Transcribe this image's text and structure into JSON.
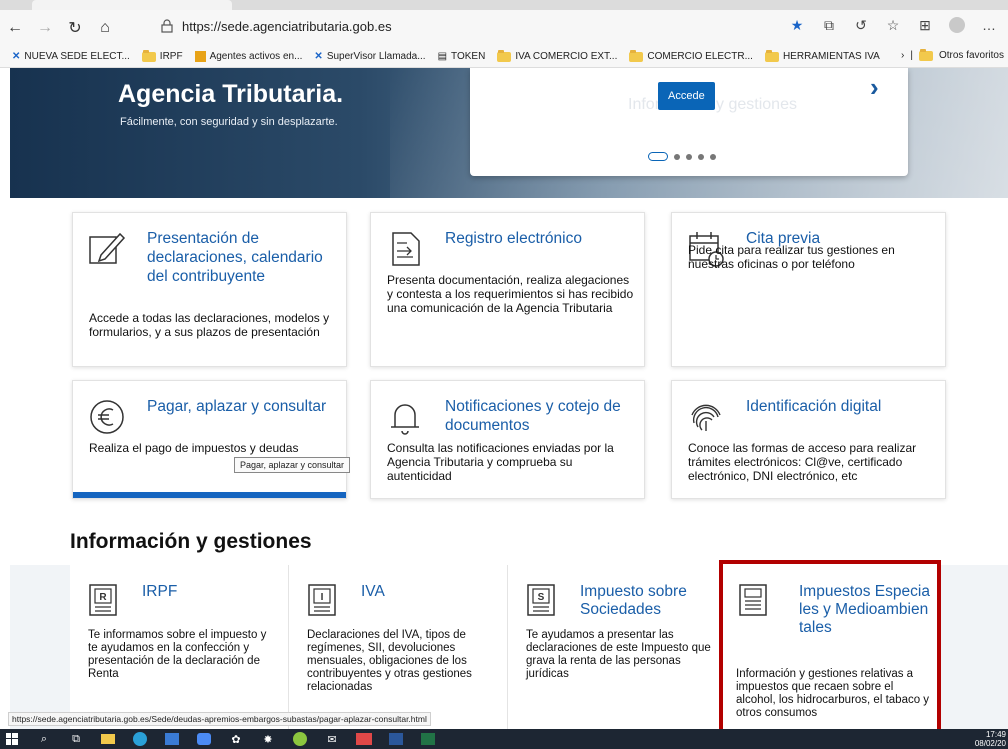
{
  "browser": {
    "url": "https://sede.agenciatributaria.gob.es",
    "bookmarks": [
      "NUEVA SEDE ELECT...",
      "IRPF",
      "Agentes activos en...",
      "SuperVisor Llamada...",
      "TOKEN",
      "IVA COMERCIO EXT...",
      "COMERCIO ELECTR...",
      "HERRAMIENTAS IVA"
    ],
    "bookmarks_more": "Otros favoritos"
  },
  "hero": {
    "title": "Agencia Tributaria.",
    "subtitle": "Fácilmente, con seguridad y sin desplazarte.",
    "button": "Accede",
    "carousel_ghost": "Información y gestiones"
  },
  "cards": [
    {
      "icon": "pencil-square-icon",
      "title": "Presentación de declaraciones, calendario del contribuyente",
      "desc": "Accede a todas las declaraciones, modelos y formularios, y a sus plazos de presentación"
    },
    {
      "icon": "document-arrow-icon",
      "title": "Registro electrónico",
      "desc": "Presenta documentación, realiza alegaciones y contesta a los requerimientos si has recibido una comunicación de la Agencia Tributaria"
    },
    {
      "icon": "calendar-clock-icon",
      "title": "Cita previa",
      "desc": "Pide cita para realizar tus gestiones en nuestras oficinas o por teléfono"
    },
    {
      "icon": "euro-circle-icon",
      "title": "Pagar, aplazar y consultar",
      "desc": "Realiza el pago de impuestos y deudas"
    },
    {
      "icon": "bell-icon",
      "title": "Notificaciones y cotejo de documentos",
      "desc": "Consulta las notificaciones enviadas por la Agencia Tributaria y comprueba su autenticidad"
    },
    {
      "icon": "fingerprint-icon",
      "title": "Identificación digital",
      "desc": "Conoce las formas de acceso para realizar trámites electrónicos: Cl@ve, certificado electrónico, DNI electrónico, etc"
    }
  ],
  "tooltip": "Pagar, aplazar y consultar",
  "section": {
    "title": "Información y gestiones",
    "items": [
      {
        "letter": "R",
        "title": "IRPF",
        "desc": "Te informamos sobre el impuesto y te ayudamos en la confección y presentación de la declaración de Renta"
      },
      {
        "letter": "I",
        "title": "IVA",
        "desc": "Declaraciones del IVA, tipos de regímenes, SII, devoluciones mensuales, obligaciones de los contribuyentes y otras gestiones relacionadas"
      },
      {
        "letter": "S",
        "title": "Impuesto sobre Sociedades",
        "desc": "Te ayudamos a presentar las declaraciones de este Impuesto que grava la renta de las personas jurídicas"
      },
      {
        "letter": "",
        "title": "Impuestos Especiales y Medioambientales",
        "desc": "Información y gestiones relativas a impuestos que recaen sobre el alcohol, los hidrocarburos, el tabaco y otros consumos"
      }
    ]
  },
  "status_url": "https://sede.agenciatributaria.gob.es/Sede/deudas-apremios-embargos-subastas/pagar-aplazar-consultar.html",
  "clock": {
    "time": "17:49",
    "date": "08/02/20"
  },
  "colors": {
    "link": "#1a5ea8",
    "accent": "#1565c0",
    "highlight": "#b20000"
  }
}
